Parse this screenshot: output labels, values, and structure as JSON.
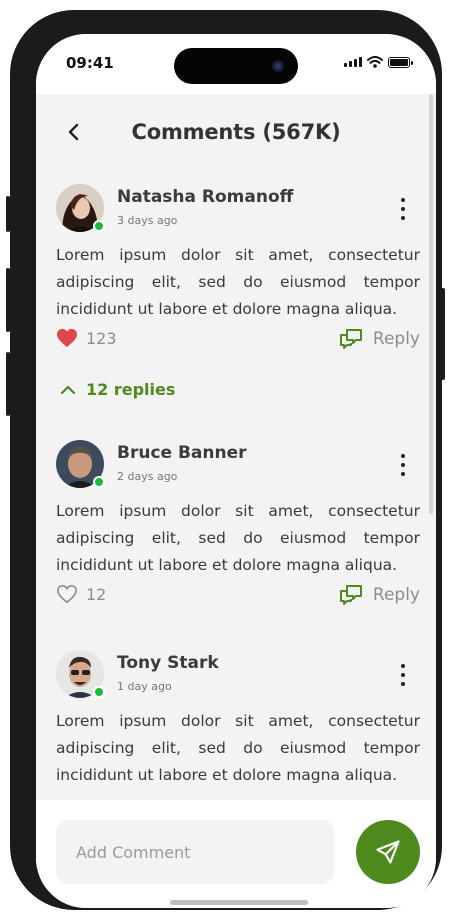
{
  "status_bar": {
    "time": "09:41"
  },
  "header": {
    "title": "Comments (567K)"
  },
  "comments": [
    {
      "author": "Natasha Romanoff",
      "time": "3 days ago",
      "text": "Lorem ipsum dolor sit amet, consectetur adipiscing elit, sed do eiusmod tempor incididunt ut labore et dolore magna aliqua.",
      "likes": "123",
      "liked": true,
      "reply_label": "Reply",
      "replies_label": "12 replies",
      "online": true
    },
    {
      "author": "Bruce Banner",
      "time": "2 days ago",
      "text": "Lorem ipsum dolor sit amet, consectetur adipiscing elit, sed do eiusmod tempor incididunt ut labore et dolore magna aliqua.",
      "likes": "12",
      "liked": false,
      "reply_label": "Reply",
      "online": true
    },
    {
      "author": "Tony Stark",
      "time": "1 day ago",
      "text": "Lorem ipsum dolor sit amet, consectetur adipiscing elit, sed do eiusmod tempor incididunt ut labore et dolore magna aliqua.",
      "online": true
    }
  ],
  "composer": {
    "placeholder": "Add Comment"
  },
  "icons": {
    "back": "chevron-left-icon",
    "more": "more-vertical-icon",
    "like": "heart-icon",
    "reply": "reply-bubbles-icon",
    "replies_toggle": "chevron-up-icon",
    "send": "send-icon"
  },
  "colors": {
    "accent": "#4f8a1f",
    "liked_heart": "#e0474c",
    "online": "#1fb93a",
    "screen_bg": "#f3f3f3"
  }
}
